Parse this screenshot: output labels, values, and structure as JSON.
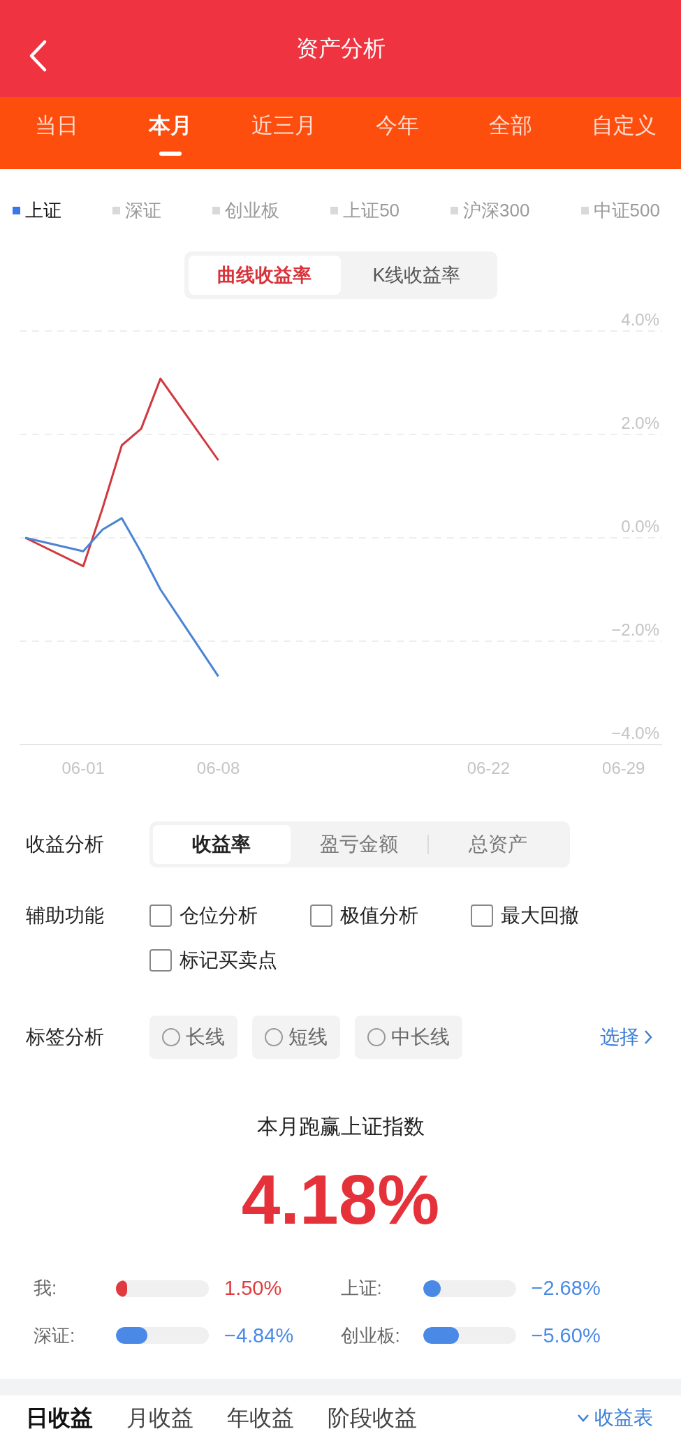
{
  "header": {
    "title": "资产分析"
  },
  "period_tabs": [
    {
      "label": "当日",
      "selected": false
    },
    {
      "label": "本月",
      "selected": true
    },
    {
      "label": "近三月",
      "selected": false
    },
    {
      "label": "今年",
      "selected": false
    },
    {
      "label": "全部",
      "selected": false
    },
    {
      "label": "自定义",
      "selected": false
    }
  ],
  "index_legend": [
    {
      "label": "上证",
      "selected": true
    },
    {
      "label": "深证",
      "selected": false
    },
    {
      "label": "创业板",
      "selected": false
    },
    {
      "label": "上证50",
      "selected": false
    },
    {
      "label": "沪深300",
      "selected": false
    },
    {
      "label": "中证500",
      "selected": false
    }
  ],
  "chart_mode": [
    {
      "label": "曲线收益率",
      "selected": true
    },
    {
      "label": "K线收益率",
      "selected": false
    }
  ],
  "chart_data": {
    "type": "line",
    "grid": true,
    "categories": [
      null,
      null,
      null,
      "06-01",
      null,
      null,
      null,
      null,
      null,
      null,
      "06-08",
      null,
      null,
      null,
      null,
      null,
      null,
      null,
      null,
      null,
      null,
      null,
      null,
      null,
      "06-22",
      null,
      null,
      null,
      null,
      null,
      null,
      "06-29",
      null
    ],
    "ylim": [
      -4,
      4
    ],
    "yticks": [
      {
        "value": 4,
        "label": "4.0%"
      },
      {
        "value": 2,
        "label": "2.0%"
      },
      {
        "value": 0,
        "label": "0.0%"
      },
      {
        "value": -2,
        "label": "−2.0%"
      },
      {
        "value": -4,
        "label": "−4.0%"
      }
    ],
    "series": [
      {
        "color": "#d0393f",
        "values": [
          0,
          null,
          null,
          -0.55,
          0.57,
          1.79,
          2.11,
          3.08,
          null,
          null,
          1.5,
          null,
          null,
          null,
          null,
          null,
          null,
          null,
          null,
          null,
          null,
          null,
          null,
          null,
          null,
          null,
          null,
          null,
          null,
          null,
          null,
          null,
          null
        ]
      },
      {
        "color": "#4a84d4",
        "values": [
          0,
          null,
          null,
          -0.26,
          0.16,
          0.38,
          -0.28,
          -1.0,
          null,
          null,
          -2.68,
          null,
          null,
          null,
          null,
          null,
          null,
          null,
          null,
          null,
          null,
          null,
          null,
          null,
          null,
          null,
          null,
          null,
          null,
          null,
          null,
          null,
          null
        ]
      }
    ]
  },
  "return_analysis": {
    "label": "收益分析",
    "options": [
      {
        "label": "收益率",
        "selected": true
      },
      {
        "label": "盈亏金额",
        "selected": false
      },
      {
        "label": "总资产",
        "selected": false
      }
    ]
  },
  "aux_functions": {
    "label": "辅助功能",
    "options": [
      {
        "label": "仓位分析",
        "checked": false
      },
      {
        "label": "极值分析",
        "checked": false
      },
      {
        "label": "最大回撤",
        "checked": false
      },
      {
        "label": "标记买卖点",
        "checked": false
      }
    ]
  },
  "tag_analysis": {
    "label": "标签分析",
    "options": [
      {
        "label": "长线",
        "selected": false
      },
      {
        "label": "短线",
        "selected": false
      },
      {
        "label": "中长线",
        "selected": false
      }
    ],
    "link": "选择"
  },
  "summary": {
    "title": "本月跑赢上证指数",
    "value": "4.18%"
  },
  "comparisons": [
    {
      "label": "我:",
      "level": 0.12,
      "value": "1.50%",
      "color": "#e03a3e"
    },
    {
      "label": "上证:",
      "level": 0.19,
      "value": "−2.68%",
      "color": "#4a8ae6"
    },
    {
      "label": "深证:",
      "level": 0.34,
      "value": "−4.84%",
      "color": "#4a8ae6"
    },
    {
      "label": "创业板:",
      "level": 0.39,
      "value": "−5.60%",
      "color": "#4a8ae6"
    }
  ],
  "bottom_tabs": [
    {
      "label": "日收益",
      "selected": true
    },
    {
      "label": "月收益",
      "selected": false
    },
    {
      "label": "年收益",
      "selected": false
    },
    {
      "label": "阶段收益",
      "selected": false
    }
  ],
  "bottom_link": "收益表"
}
